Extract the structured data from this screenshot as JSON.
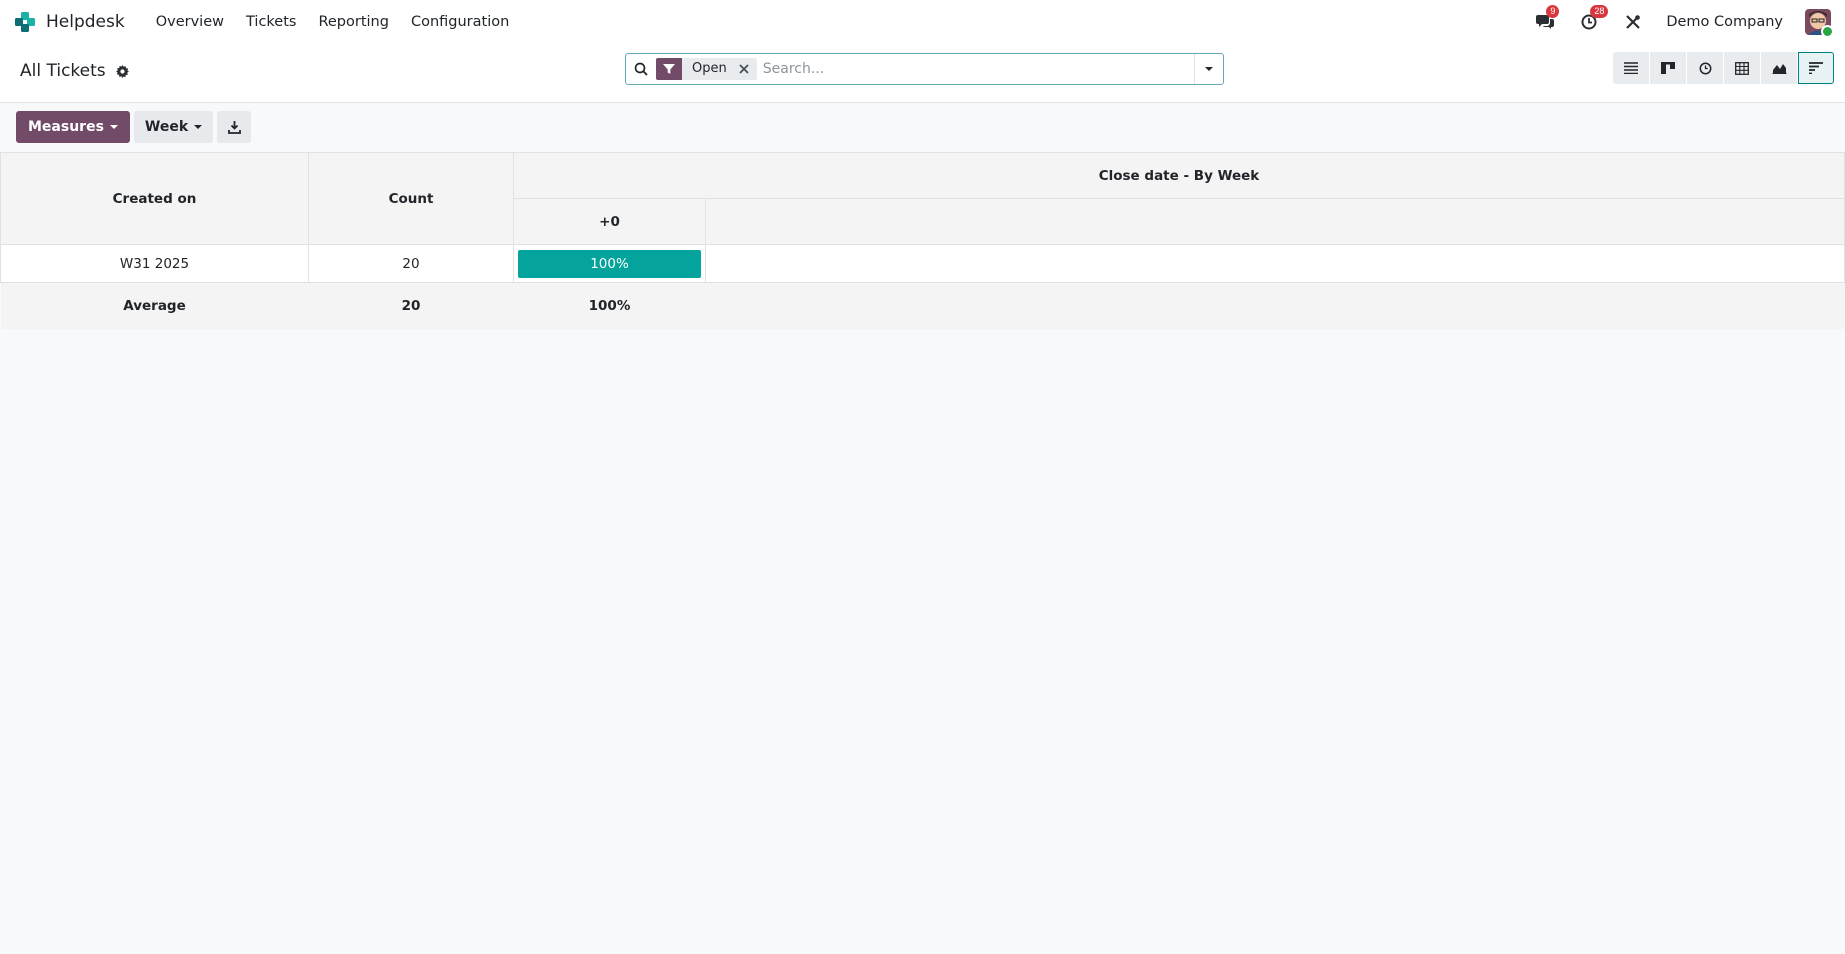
{
  "navbar": {
    "app_name": "Helpdesk",
    "menu": [
      "Overview",
      "Tickets",
      "Reporting",
      "Configuration"
    ],
    "messages_badge": "9",
    "activities_badge": "28",
    "company": "Demo Company"
  },
  "control_panel": {
    "title": "All Tickets",
    "search": {
      "facet_label": "Open",
      "placeholder": "Search..."
    }
  },
  "toolbar": {
    "measures_label": "Measures",
    "interval_label": "Week"
  },
  "table": {
    "row_header": "Created on",
    "count_header": "Count",
    "group_header": "Close date - By Week",
    "interval_header": "+0",
    "rows": [
      {
        "label": "W31 2025",
        "count": "20",
        "value": "100%"
      }
    ],
    "average": {
      "label": "Average",
      "count": "20",
      "value": "100%"
    }
  },
  "colors": {
    "brand": "#714b67",
    "accent": "#017e84",
    "cohort_cell": "#04a49c",
    "badge": "#d9363e"
  }
}
